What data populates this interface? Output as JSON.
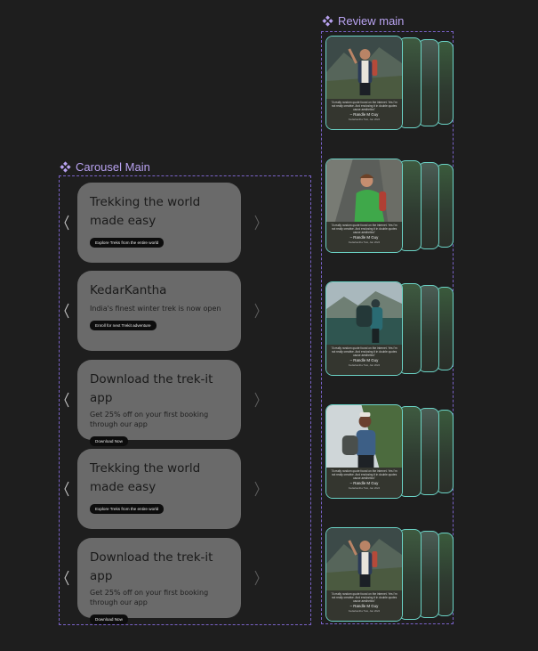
{
  "carousel": {
    "frame_label": "Carousel Main",
    "slides": [
      {
        "title": "Trekking the world made easy",
        "subtitle": "",
        "button": "Explore Treks from the entire world"
      },
      {
        "title": "KedarKantha",
        "subtitle": "India's finest winter trek is now open",
        "button": "Enroll for next Trekit adventure"
      },
      {
        "title": "Download the trek-it app",
        "subtitle": "Get 25% off on your first booking through our app",
        "button": "Download Now"
      },
      {
        "title": "Trekking the world made easy",
        "subtitle": "",
        "button": "Explore Treks from the entire world"
      },
      {
        "title": "Download the trek-it app",
        "subtitle": "Get 25% off on your first booking through our app",
        "button": "Download Now"
      }
    ]
  },
  "review": {
    "frame_label": "Review main",
    "card": {
      "quote": "\"A really random quote found on the internet. Yes I'm not really creative. And enclosing it in double quotes cause aesthetics\"",
      "author": "– Randle M Guy",
      "meta": "Kedarkantha Trek, Jan 2024"
    }
  },
  "colors": {
    "background": "#1e1e1e",
    "frame_border": "#7a62c8",
    "component_label": "#b8a2f0",
    "card": "#6a6a6a",
    "pill": "#0d0d0d",
    "review_border": "#6bd3c6"
  }
}
